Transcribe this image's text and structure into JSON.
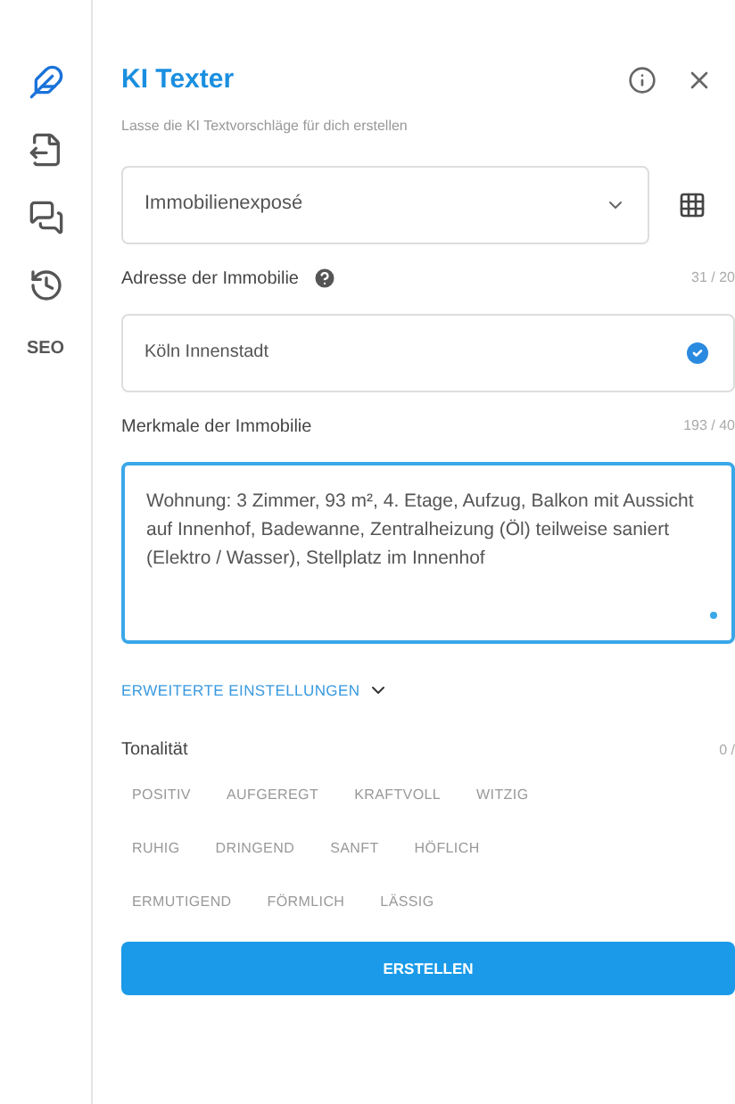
{
  "sidebar": {
    "items": [
      {
        "kind": "logo",
        "selected": true
      },
      {
        "kind": "doc"
      },
      {
        "kind": "chat"
      },
      {
        "kind": "history"
      },
      {
        "kind": "text",
        "label": "SEO"
      }
    ]
  },
  "header": {
    "title": "KI Texter",
    "subtitle": "Lasse die KI Textvorschläge für dich erstellen"
  },
  "template_select": {
    "value": "Immobilienexposé"
  },
  "address": {
    "label": "Adresse der Immobilie",
    "counter": "31 / 20",
    "value": "Köln Innenstadt",
    "valid": true
  },
  "features": {
    "label": "Merkmale der Immobilie",
    "counter": "193 / 40",
    "value": "Wohnung: 3 Zimmer, 93 m², 4. Etage, Aufzug, Balkon mit Aussicht auf Innenhof, Badewanne, Zentralheizung (Öl) teilweise saniert (Elektro / Wasser), Stellplatz im Innenhof",
    "focused": true
  },
  "advanced": {
    "label": "ERWEITERTE EINSTELLUNGEN",
    "expanded": false
  },
  "tonality": {
    "label": "Tonalität",
    "counter": "0 /",
    "rows": [
      [
        {
          "label": "POSITIV",
          "selected": false
        },
        {
          "label": "AUFGEREGT",
          "selected": false
        },
        {
          "label": "KRAFTVOLL",
          "selected": false
        },
        {
          "label": "WITZIG",
          "selected": false
        }
      ],
      [
        {
          "label": "RUHIG",
          "selected": false
        },
        {
          "label": "DRINGEND",
          "selected": false
        },
        {
          "label": "SANFT",
          "selected": false
        },
        {
          "label": "HÖFLICH",
          "selected": false
        }
      ],
      [
        {
          "label": "ERMUTIGEND",
          "selected": false
        },
        {
          "label": "FÖRMLICH",
          "selected": false
        },
        {
          "label": "LÄSSIG",
          "selected": false
        }
      ]
    ]
  },
  "submit": {
    "label": "ERSTELLEN"
  }
}
